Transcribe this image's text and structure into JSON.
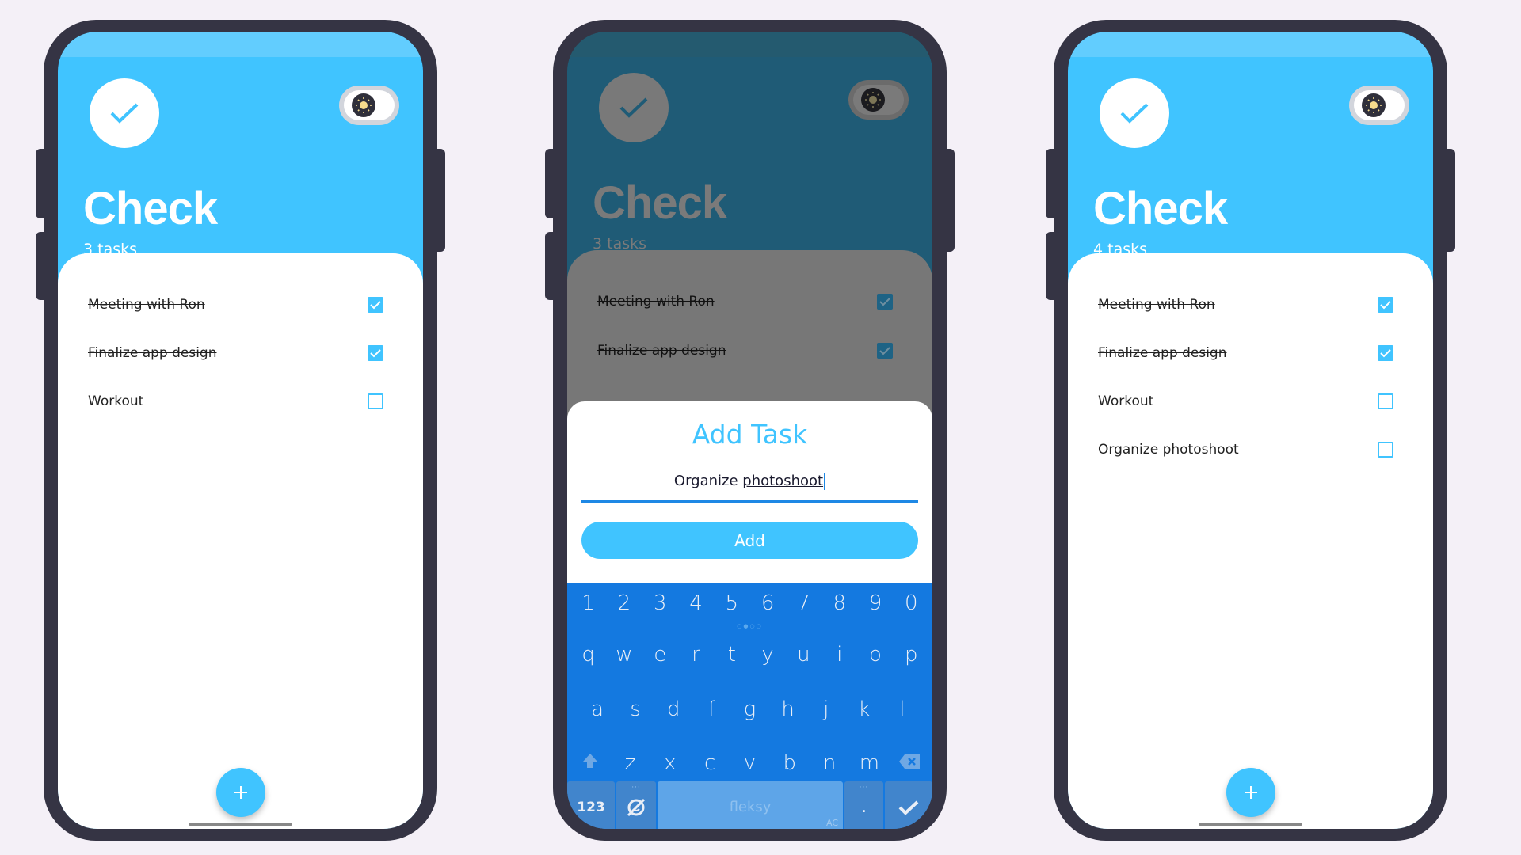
{
  "colors": {
    "accent": "#40c4ff",
    "background": "#f4f0f7",
    "phone_frame": "#353444",
    "keyboard": "#1479e0"
  },
  "screens": [
    {
      "app_title": "Check",
      "task_count": "3 tasks",
      "logo_icon": "check-icon",
      "theme_toggle_icon": "sun-icon",
      "tasks": [
        {
          "label": "Meeting with Ron",
          "done": true
        },
        {
          "label": "Finalize app design",
          "done": true
        },
        {
          "label": "Workout",
          "done": false
        }
      ],
      "fab_label": "+"
    },
    {
      "app_title": "Check",
      "task_count": "3 tasks",
      "logo_icon": "check-icon",
      "theme_toggle_icon": "sun-icon",
      "tasks": [
        {
          "label": "Meeting with Ron",
          "done": true
        },
        {
          "label": "Finalize app design",
          "done": true
        }
      ],
      "dialog": {
        "title": "Add Task",
        "input_value_prefix": "Organize ",
        "input_value_underlined": "photoshoot",
        "add_button": "Add"
      },
      "keyboard": {
        "number_row": [
          "1",
          "2",
          "3",
          "4",
          "5",
          "6",
          "7",
          "8",
          "9",
          "0"
        ],
        "row1": [
          "q",
          "w",
          "e",
          "r",
          "t",
          "y",
          "u",
          "i",
          "o",
          "p"
        ],
        "row2": [
          "a",
          "s",
          "d",
          "f",
          "g",
          "h",
          "j",
          "k",
          "l"
        ],
        "row3": [
          "z",
          "x",
          "c",
          "v",
          "b",
          "n",
          "m"
        ],
        "pager_dots": "○●○○",
        "numbers_key": "123",
        "space_label": "fleksy",
        "autocorrect_label": "AC",
        "period_key": ".",
        "more_dots": "···"
      }
    },
    {
      "app_title": "Check",
      "task_count": "4 tasks",
      "logo_icon": "check-icon",
      "theme_toggle_icon": "sun-icon",
      "tasks": [
        {
          "label": "Meeting with Ron",
          "done": true
        },
        {
          "label": "Finalize app design",
          "done": true
        },
        {
          "label": "Workout",
          "done": false
        },
        {
          "label": "Organize photoshoot",
          "done": false
        }
      ],
      "fab_label": "+"
    }
  ]
}
